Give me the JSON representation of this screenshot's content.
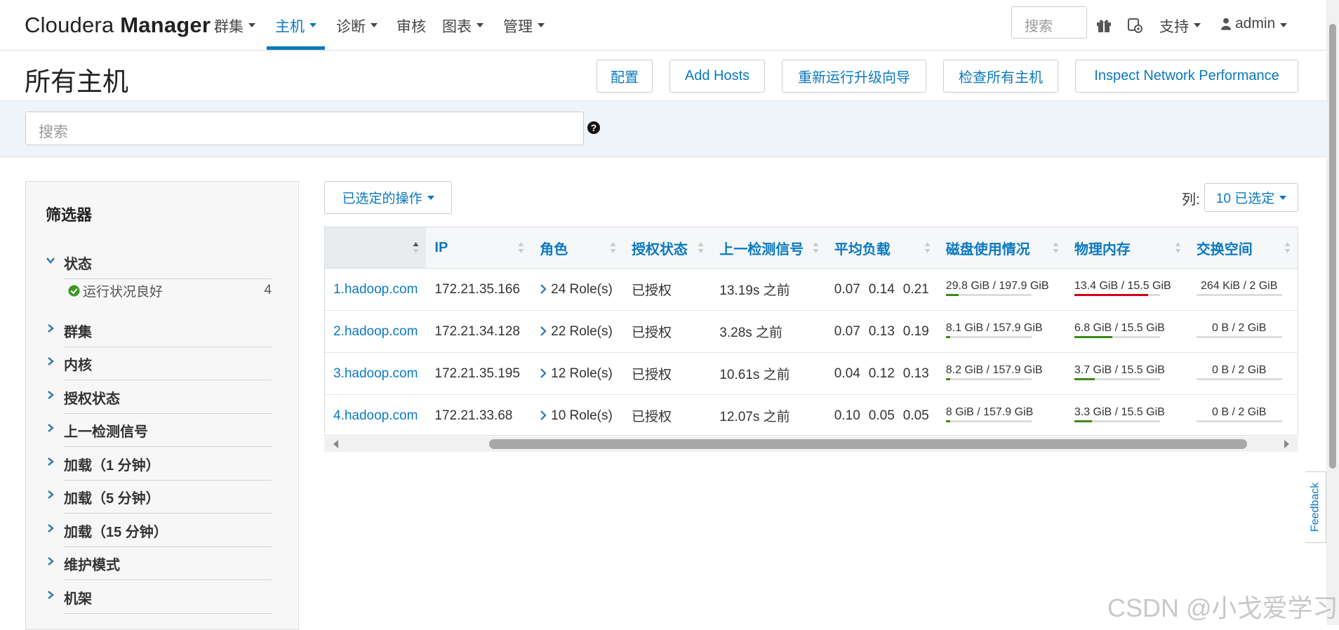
{
  "brand": {
    "light": "Cloudera ",
    "bold": "Manager"
  },
  "nav": {
    "clusters": "群集",
    "hosts": "主机",
    "diagnostics": "诊断",
    "audits": "审核",
    "charts": "图表",
    "admin": "管理",
    "search_placeholder": "搜索",
    "support": "支持",
    "user": "admin"
  },
  "page": {
    "title": "所有主机",
    "buttons": {
      "configure": "配置",
      "add_hosts": "Add Hosts",
      "rerun_upgrade": "重新运行升级向导",
      "inspect_all": "检查所有主机",
      "inspect_network": "Inspect Network Performance"
    },
    "search_placeholder": "搜索"
  },
  "sidebar": {
    "title": "筛选器",
    "status": {
      "label": "状态",
      "sub_label": "运行状况良好",
      "sub_count": "4"
    },
    "sections": [
      "群集",
      "内核",
      "授权状态",
      "上一检测信号",
      "加载（1 分钟）",
      "加载（5 分钟）",
      "加载（15 分钟）",
      "维护模式",
      "机架"
    ]
  },
  "toolbar": {
    "actions": "已选定的操作",
    "columns_label": "列:",
    "columns_selected": "10 已选定"
  },
  "table": {
    "headers": [
      "IP",
      "角色",
      "授权状态",
      "上一检测信号",
      "平均负载",
      "磁盘使用情况",
      "物理内存",
      "交换空间"
    ],
    "rows": [
      {
        "host": "1.hadoop.com",
        "ip": "172.21.35.166",
        "roles": "24 Role(s)",
        "auth": "已授权",
        "heartbeat": "13.19s 之前",
        "load1": "0.07",
        "load5": "0.14",
        "load15": "0.21",
        "disk": "29.8 GiB / 197.9 GiB",
        "disk_frac": 0.15,
        "mem": "13.4 GiB / 15.5 GiB",
        "mem_frac": 0.86,
        "swap": "264 KiB / 2 GiB",
        "swap_frac": 0.0
      },
      {
        "host": "2.hadoop.com",
        "ip": "172.21.34.128",
        "roles": "22 Role(s)",
        "auth": "已授权",
        "heartbeat": "3.28s 之前",
        "load1": "0.07",
        "load5": "0.13",
        "load15": "0.19",
        "disk": "8.1 GiB / 157.9 GiB",
        "disk_frac": 0.05,
        "mem": "6.8 GiB / 15.5 GiB",
        "mem_frac": 0.44,
        "swap": "0 B / 2 GiB",
        "swap_frac": 0.0
      },
      {
        "host": "3.hadoop.com",
        "ip": "172.21.35.195",
        "roles": "12 Role(s)",
        "auth": "已授权",
        "heartbeat": "10.61s 之前",
        "load1": "0.04",
        "load5": "0.12",
        "load15": "0.13",
        "disk": "8.2 GiB / 157.9 GiB",
        "disk_frac": 0.05,
        "mem": "3.7 GiB / 15.5 GiB",
        "mem_frac": 0.24,
        "swap": "0 B / 2 GiB",
        "swap_frac": 0.0
      },
      {
        "host": "4.hadoop.com",
        "ip": "172.21.33.68",
        "roles": "10 Role(s)",
        "auth": "已授权",
        "heartbeat": "12.07s 之前",
        "load1": "0.10",
        "load5": "0.05",
        "load15": "0.05",
        "disk": "8 GiB / 157.9 GiB",
        "disk_frac": 0.05,
        "mem": "3.3 GiB / 15.5 GiB",
        "mem_frac": 0.21,
        "swap": "0 B / 2 GiB",
        "swap_frac": 0.0
      }
    ]
  },
  "feedback": "Feedback",
  "watermark": "CSDN @小戈爱学习",
  "colors": {
    "accent": "#0b79c1",
    "ok": "#3a9a22",
    "high": "#d0021b",
    "bar_green": "#3c8a16"
  }
}
